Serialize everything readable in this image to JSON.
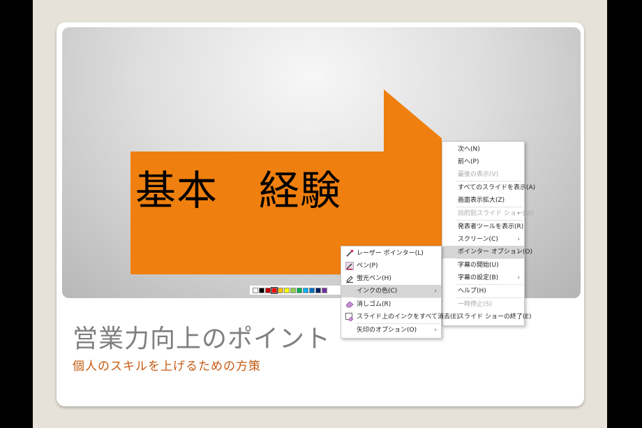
{
  "slide": {
    "callout_text": "基本　経験",
    "title": "営業力向上のポイント",
    "subtitle": "個人のスキルを上げるための方策",
    "callout_color": "#ef7f0e"
  },
  "palette": {
    "colors": [
      "#ffffff",
      "#000000",
      "#c00000",
      "#ff0000",
      "#ffc000",
      "#ffff00",
      "#92d050",
      "#00b050",
      "#00b0f0",
      "#0070c0",
      "#002060",
      "#7030a0"
    ]
  },
  "context_menu": {
    "items": [
      {
        "label": "次へ(N)",
        "disabled": false
      },
      {
        "label": "前へ(P)",
        "disabled": false
      },
      {
        "label": "最後の表示(V)",
        "disabled": true
      },
      {
        "label": "すべてのスライドを表示(A)",
        "disabled": false
      },
      {
        "label": "画面表示拡大(Z)",
        "disabled": false
      },
      {
        "label": "目的別スライド ショー(W)",
        "disabled": true
      },
      {
        "label": "発表者ツールを表示(R)",
        "disabled": false
      },
      {
        "label": "スクリーン(C)",
        "disabled": false
      },
      {
        "label": "ポインター オプション(O)",
        "disabled": false
      },
      {
        "label": "字幕の開始(U)",
        "disabled": false
      },
      {
        "label": "字幕の設定(B)",
        "disabled": false
      },
      {
        "label": "ヘルプ(H)",
        "disabled": false
      },
      {
        "label": "一時停止(S)",
        "disabled": true
      },
      {
        "label": "スライド ショーの終了(E)",
        "disabled": false
      }
    ]
  },
  "pointer_submenu": {
    "items": [
      {
        "label": "レーザー ポインター(L)",
        "icon": "laser-pointer-icon"
      },
      {
        "label": "ペン(P)",
        "icon": "pen-icon"
      },
      {
        "label": "蛍光ペン(H)",
        "icon": "highlighter-icon"
      },
      {
        "label": "インクの色(C)",
        "icon": ""
      },
      {
        "label": "消しゴム(R)",
        "icon": "eraser-icon"
      },
      {
        "label": "スライド上のインクをすべて消去(E)",
        "icon": "erase-all-ink-icon"
      },
      {
        "label": "矢印のオプション(O)",
        "icon": ""
      }
    ]
  }
}
